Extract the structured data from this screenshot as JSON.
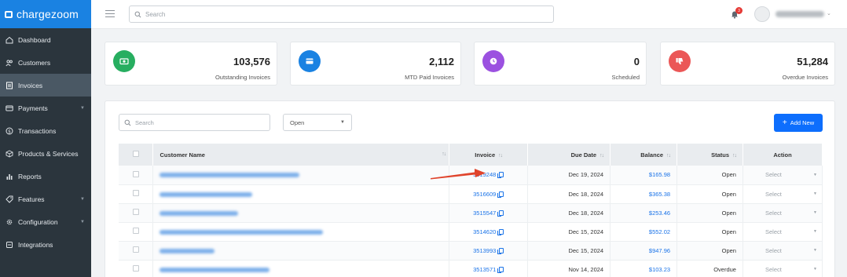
{
  "brand": {
    "name": "chargezoom"
  },
  "sidebar": {
    "items": [
      {
        "label": "Dashboard",
        "icon": "home-icon"
      },
      {
        "label": "Customers",
        "icon": "users-icon"
      },
      {
        "label": "Invoices",
        "icon": "invoice-icon",
        "active": true
      },
      {
        "label": "Payments",
        "icon": "card-icon",
        "has_submenu": true
      },
      {
        "label": "Transactions",
        "icon": "dollar-icon"
      },
      {
        "label": "Products & Services",
        "icon": "box-icon"
      },
      {
        "label": "Reports",
        "icon": "bar-chart-icon"
      },
      {
        "label": "Features",
        "icon": "tag-icon",
        "has_submenu": true
      },
      {
        "label": "Configuration",
        "icon": "gear-icon",
        "has_submenu": true
      },
      {
        "label": "Integrations",
        "icon": "plug-icon"
      }
    ]
  },
  "topbar": {
    "search_placeholder": "Search",
    "notification_count": "3"
  },
  "stats": [
    {
      "value": "103,576",
      "label": "Outstanding Invoices",
      "color": "#27ae60",
      "icon": "cash-icon"
    },
    {
      "value": "2,112",
      "label": "MTD Paid Invoices",
      "color": "#1a82e2",
      "icon": "card-icon"
    },
    {
      "value": "0",
      "label": "Scheduled",
      "color": "#9b51e0",
      "icon": "clock-icon"
    },
    {
      "value": "51,284",
      "label": "Overdue Invoices",
      "color": "#eb5757",
      "icon": "thumbs-down-icon"
    }
  ],
  "table_controls": {
    "search_placeholder": "Search",
    "filter_value": "Open",
    "add_label": "Add New"
  },
  "table": {
    "headers": {
      "customer": "Customer Name",
      "invoice": "Invoice",
      "due": "Due Date",
      "balance": "Balance",
      "status": "Status",
      "action": "Action"
    },
    "rows": [
      {
        "invoice": "3519248",
        "due": "Dec 19, 2024",
        "balance": "$165.98",
        "status": "Open",
        "action": "Select"
      },
      {
        "invoice": "3516609",
        "due": "Dec 18, 2024",
        "balance": "$365.38",
        "status": "Open",
        "action": "Select"
      },
      {
        "invoice": "3515547",
        "due": "Dec 18, 2024",
        "balance": "$253.46",
        "status": "Open",
        "action": "Select"
      },
      {
        "invoice": "3514620",
        "due": "Dec 15, 2024",
        "balance": "$552.02",
        "status": "Open",
        "action": "Select"
      },
      {
        "invoice": "3513993",
        "due": "Dec 15, 2024",
        "balance": "$947.96",
        "status": "Open",
        "action": "Select"
      },
      {
        "invoice": "3513571",
        "due": "Nov 14, 2024",
        "balance": "$103.23",
        "status": "Overdue",
        "action": "Select"
      }
    ]
  },
  "annotation": {
    "arrow_color": "#e0442c"
  }
}
